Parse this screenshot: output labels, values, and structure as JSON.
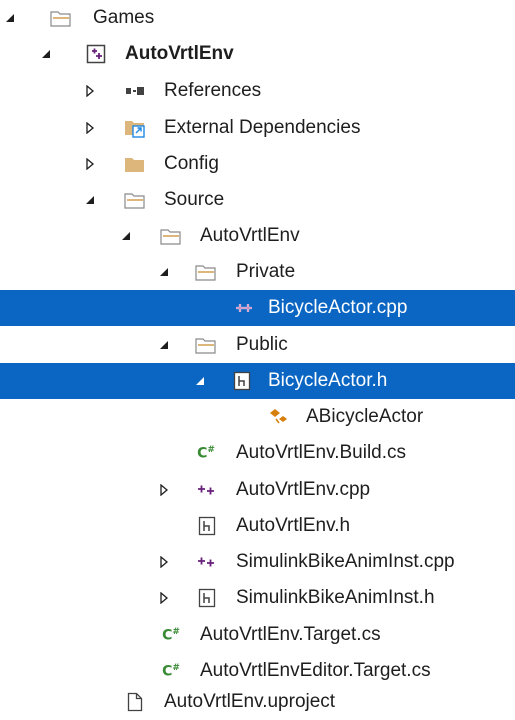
{
  "tree": {
    "games": "Games",
    "project": "AutoVrtlEnv",
    "references": "References",
    "external_dependencies": "External Dependencies",
    "config": "Config",
    "source": "Source",
    "source_module": "AutoVrtlEnv",
    "private": "Private",
    "bicycle_actor_cpp": "BicycleActor.cpp",
    "public": "Public",
    "bicycle_actor_h": "BicycleActor.h",
    "abicycle_actor": "ABicycleActor",
    "build_cs": "AutoVrtlEnv.Build.cs",
    "module_cpp": "AutoVrtlEnv.cpp",
    "module_h": "AutoVrtlEnv.h",
    "anim_cpp": "SimulinkBikeAnimInst.cpp",
    "anim_h": "SimulinkBikeAnimInst.h",
    "target_cs": "AutoVrtlEnv.Target.cs",
    "editor_target_cs": "AutoVrtlEnvEditor.Target.cs",
    "uproject": "AutoVrtlEnv.uproject"
  },
  "colors": {
    "selection": "#0a66c2",
    "folder": "#dcb67a",
    "cpp": "#68217a",
    "csharp": "#388a34"
  },
  "icons": {
    "expanded": "expanded-arrow-icon",
    "collapsed": "collapsed-arrow-icon",
    "folder": "folder-icon",
    "project": "project-icon",
    "references": "references-icon",
    "external": "external-dependencies-icon",
    "cpp": "cpp-file-icon",
    "header": "header-file-icon",
    "csharp": "csharp-file-icon",
    "class": "class-icon",
    "file": "file-icon"
  }
}
